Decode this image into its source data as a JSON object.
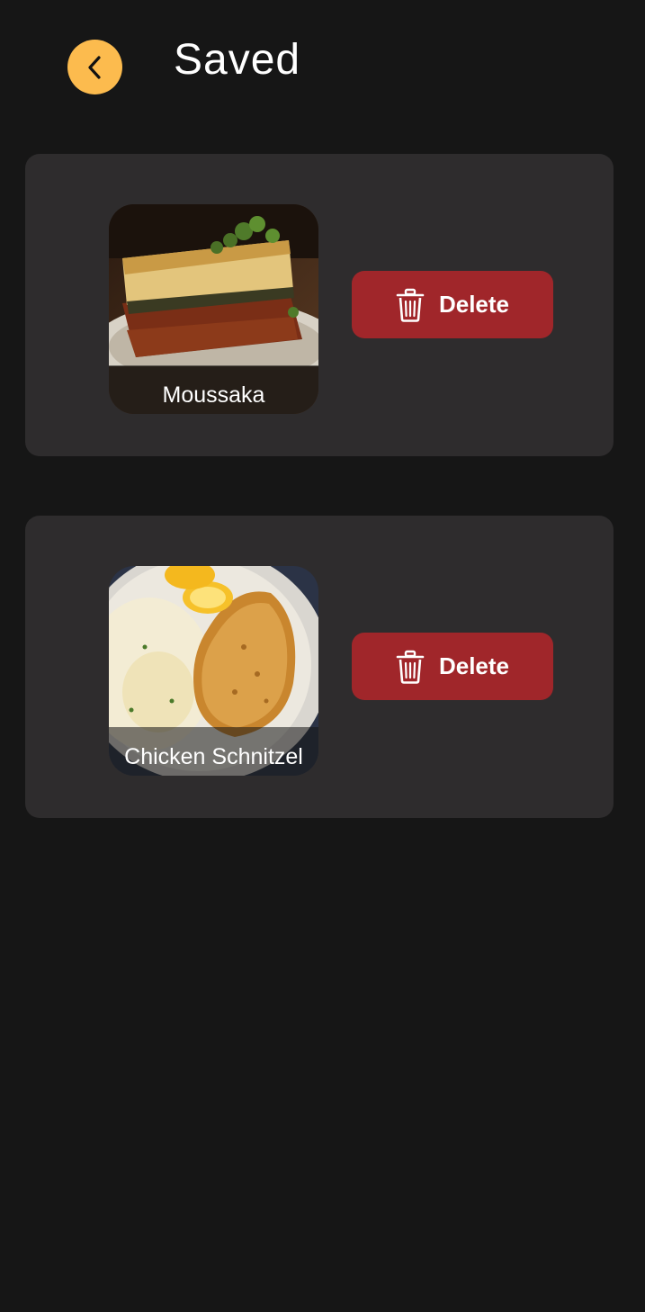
{
  "header": {
    "title": "Saved",
    "back_icon": "chevron-left-icon"
  },
  "colors": {
    "background": "#161616",
    "card": "#2E2C2D",
    "accent": "#FCBB4E",
    "delete": "#A0262A",
    "text": "#FFFFFF"
  },
  "saved": [
    {
      "name": "Moussaka",
      "delete_label": "Delete",
      "delete_icon": "trash-icon"
    },
    {
      "name": "Chicken Schnitzel",
      "delete_label": "Delete",
      "delete_icon": "trash-icon"
    }
  ]
}
